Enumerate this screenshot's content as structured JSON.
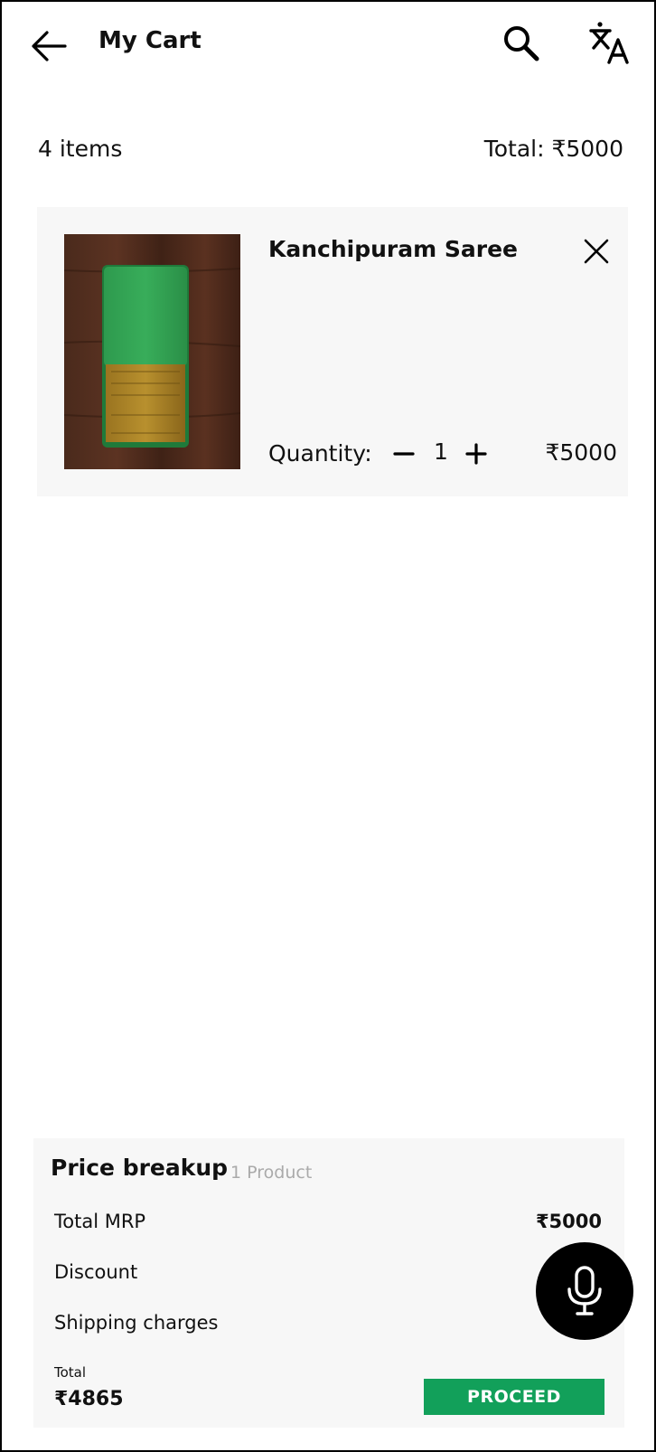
{
  "header": {
    "title": "My Cart",
    "back_icon": "arrow-left-icon",
    "search_icon": "search-icon",
    "translate_icon": "translate-icon"
  },
  "summary": {
    "items_count": "4 items",
    "total": "Total: ₹5000"
  },
  "cart_items": [
    {
      "name": "Kanchipuram Saree",
      "quantity_label": "Quantity:",
      "quantity": "1",
      "price": "₹5000"
    }
  ],
  "price_breakup": {
    "title": "Price breakup",
    "subtitle": "1 Product",
    "rows": [
      {
        "label": "Total MRP",
        "value": "₹5000"
      },
      {
        "label": "Discount",
        "value": ""
      },
      {
        "label": "Shipping charges",
        "value": ""
      }
    ],
    "total_caption": "Total",
    "total_amount": "₹4865",
    "proceed_label": "PROCEED"
  },
  "colors": {
    "accent": "#12a05a",
    "card_bg": "#f7f7f7",
    "fab_bg": "#000000"
  },
  "mic_icon": "microphone-icon"
}
